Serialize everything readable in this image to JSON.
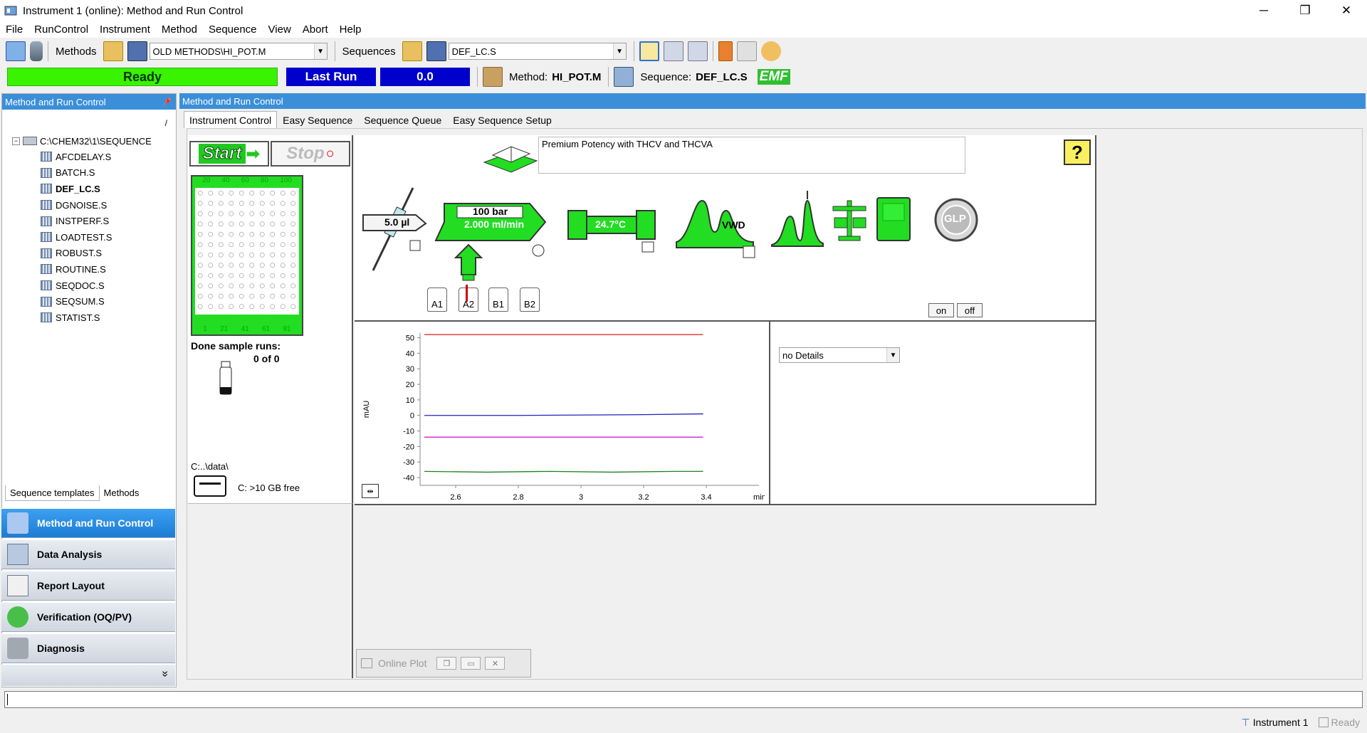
{
  "window": {
    "title": "Instrument 1 (online): Method and Run Control",
    "minimize": "─",
    "restore": "❐",
    "close": "✕"
  },
  "menu": [
    "File",
    "RunControl",
    "Instrument",
    "Method",
    "Sequence",
    "View",
    "Abort",
    "Help"
  ],
  "toolbar": {
    "methods_label": "Methods",
    "method_path": "OLD METHODS\\HI_POT.M",
    "sequences_label": "Sequences",
    "sequence_name": "DEF_LC.S"
  },
  "status": {
    "ready": "Ready",
    "last_run": "Last Run",
    "value": "0.0",
    "method_label": "Method:",
    "method_value": "HI_POT.M",
    "sequence_label": "Sequence:",
    "sequence_value": "DEF_LC.S",
    "emf": "EMF"
  },
  "left_panel": {
    "header": "Method and Run Control",
    "pin": "📌",
    "path_sep": "/",
    "tree_root": "C:\\CHEM32\\1\\SEQUENCE",
    "tree_items": [
      "AFCDELAY.S",
      "BATCH.S",
      "DEF_LC.S",
      "DGNOISE.S",
      "INSTPERF.S",
      "LOADTEST.S",
      "ROBUST.S",
      "ROUTINE.S",
      "SEQDOC.S",
      "SEQSUM.S",
      "STATIST.S"
    ],
    "bottom_tabs": [
      "Sequence templates",
      "Methods"
    ],
    "nav": [
      "Method and Run Control",
      "Data Analysis",
      "Report Layout",
      "Verification (OQ/PV)",
      "Diagnosis"
    ],
    "more": "»"
  },
  "main": {
    "header": "Method and Run Control",
    "tabs": [
      "Instrument Control",
      "Easy Sequence",
      "Sequence Queue",
      "Easy Sequence Setup"
    ],
    "start": "Start",
    "stop": "Stop",
    "tray_cols_top": [
      "20",
      "40",
      "60",
      "80",
      "100"
    ],
    "tray_cols_bottom": [
      "1",
      "21",
      "41",
      "61",
      "81"
    ],
    "done_runs_label": "Done sample runs:",
    "done_runs_value": "0 of 0",
    "data_path": "C:..\\data\\",
    "disk_free": "C: >10 GB free",
    "method_description": "Premium Potency with THCV and THCVA",
    "help": "?",
    "injector_volume": "5.0 µl",
    "pump_pressure": "100 bar",
    "pump_flow": "2.000 ml/min",
    "column_temp": "24.7°C",
    "detector": "VWD",
    "glp": "GLP",
    "bottles": [
      "A1",
      "A2",
      "B1",
      "B2"
    ],
    "on": "on",
    "off": "off",
    "details_select": "no Details",
    "online_plot": "Online Plot"
  },
  "chart_data": {
    "type": "line",
    "ylabel": "mAU",
    "xlabel": "min",
    "x_ticks": [
      "2.6",
      "2.8",
      "3",
      "3.2",
      "3.4"
    ],
    "y_ticks": [
      "50",
      "40",
      "30",
      "20",
      "10",
      "0",
      "-10",
      "-20",
      "-30",
      "-40"
    ],
    "xlim": [
      2.5,
      3.5
    ],
    "ylim": [
      -45,
      53
    ],
    "series": [
      {
        "color": "#e03030",
        "x": [
          2.5,
          3.39
        ],
        "y": [
          52,
          52
        ]
      },
      {
        "color": "#2020c0",
        "x": [
          2.5,
          2.8,
          3.2,
          3.39
        ],
        "y": [
          0,
          0,
          0.5,
          1
        ]
      },
      {
        "color": "#d020d0",
        "x": [
          2.5,
          3.39
        ],
        "y": [
          -14,
          -14
        ]
      },
      {
        "color": "#208020",
        "x": [
          2.5,
          2.7,
          2.9,
          3.1,
          3.3,
          3.39
        ],
        "y": [
          -36,
          -36.5,
          -36,
          -36.5,
          -36,
          -36
        ]
      }
    ]
  },
  "footer": {
    "instrument": "Instrument 1",
    "state": "Ready"
  }
}
